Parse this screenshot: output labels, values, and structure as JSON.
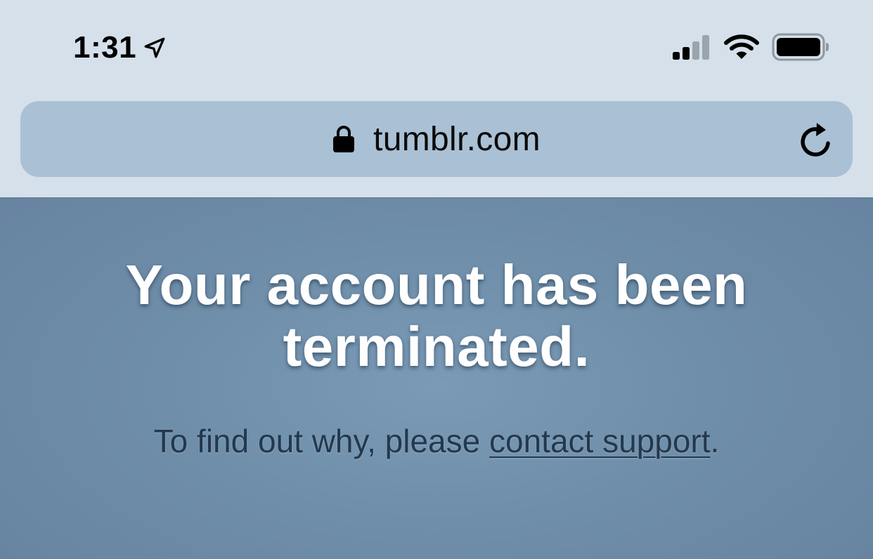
{
  "status_bar": {
    "time": "1:31",
    "icons": [
      "location-arrow-icon",
      "cellular-signal-icon",
      "wifi-icon",
      "battery-icon"
    ]
  },
  "address_bar": {
    "url": "tumblr.com",
    "icons": [
      "lock-icon",
      "reload-icon"
    ]
  },
  "page": {
    "headline_line1": "Your account has been",
    "headline_line2": "terminated.",
    "subtext_prefix": "To find out why, please ",
    "link_text": "contact support",
    "subtext_suffix": "."
  },
  "colors": {
    "status_bar_bg": "#d6e0ea",
    "address_bar_bg": "#aac0d4",
    "page_bg": "#6f8ea9",
    "headline": "#ffffff",
    "subtext": "#24384d"
  }
}
